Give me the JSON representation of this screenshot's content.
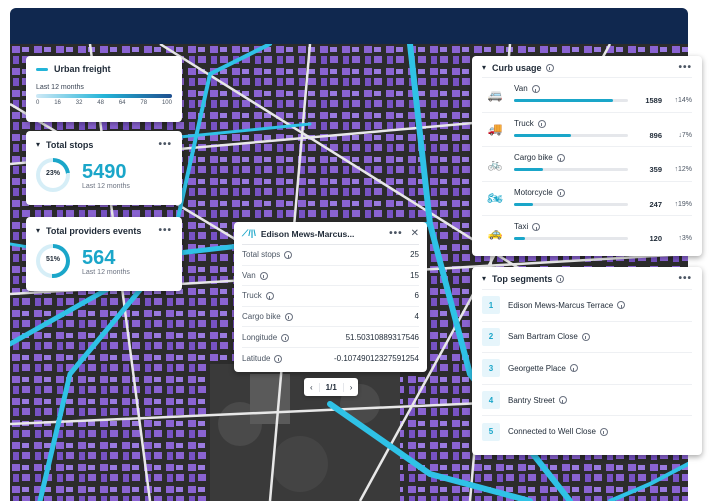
{
  "legend": {
    "title": "Urban freight",
    "subtitle": "Last 12 months",
    "ticks": [
      "0",
      "16",
      "32",
      "48",
      "64",
      "78",
      "100"
    ]
  },
  "total_stops": {
    "title": "Total stops",
    "percent": "23%",
    "percent_value": 23,
    "value": "5490",
    "sub": "Last 12 months"
  },
  "total_providers": {
    "title": "Total providers events",
    "percent": "51%",
    "percent_value": 51,
    "value": "564",
    "sub": "Last 12 months"
  },
  "popup": {
    "title": "Edison Mews-Marcus...",
    "rows": [
      {
        "label": "Total stops",
        "value": "25"
      },
      {
        "label": "Van",
        "value": "15"
      },
      {
        "label": "Truck",
        "value": "6"
      },
      {
        "label": "Cargo bike",
        "value": "4"
      },
      {
        "label": "Longitude",
        "value": "51.50310889317546"
      },
      {
        "label": "Latitude",
        "value": "-0.10749012327591254"
      }
    ]
  },
  "pager": {
    "prev": "‹",
    "page": "1/1",
    "next": "›"
  },
  "curb": {
    "title": "Curb usage",
    "rows": [
      {
        "name": "Van",
        "value": "1589",
        "change": "↑14%",
        "fill": 0.87,
        "icon": "🚐"
      },
      {
        "name": "Truck",
        "value": "896",
        "change": "↓7%",
        "fill": 0.5,
        "icon": "🚚"
      },
      {
        "name": "Cargo bike",
        "value": "359",
        "change": "↑12%",
        "fill": 0.25,
        "icon": "🚲"
      },
      {
        "name": "Motorcycle",
        "value": "247",
        "change": "↑19%",
        "fill": 0.17,
        "icon": "🏍"
      },
      {
        "name": "Taxi",
        "value": "120",
        "change": "↑3%",
        "fill": 0.1,
        "icon": "🚕"
      }
    ]
  },
  "top_segments": {
    "title": "Top segments",
    "rows": [
      {
        "rank": "1",
        "name": "Edison Mews-Marcus Terrace"
      },
      {
        "rank": "2",
        "name": "Sam Bartram Close"
      },
      {
        "rank": "3",
        "name": "Georgette Place"
      },
      {
        "rank": "4",
        "name": "Bantry Street"
      },
      {
        "rank": "5",
        "name": "Connected to Well Close"
      }
    ]
  },
  "colors": {
    "accent": "#1aa6c9",
    "building": "#8a63d2",
    "header": "#10284f",
    "map_bg": "#242424"
  }
}
